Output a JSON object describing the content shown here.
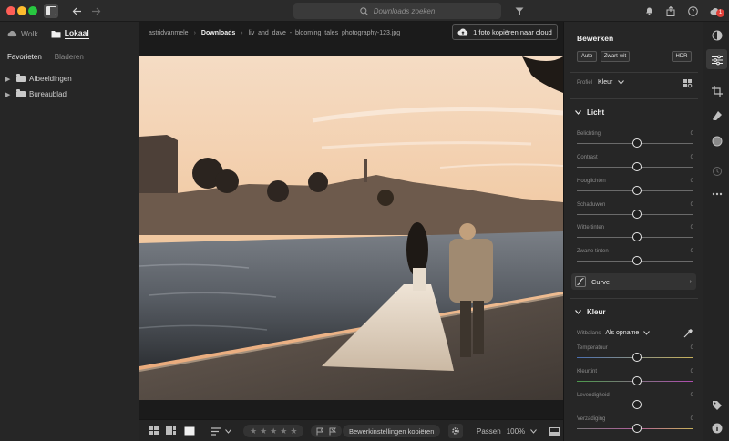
{
  "search": {
    "placeholder": "Downloads zoeken"
  },
  "left_panel": {
    "source_tabs": [
      {
        "label": "Wolk"
      },
      {
        "label": "Lokaal"
      }
    ],
    "sub_tabs": [
      {
        "label": "Favorieten"
      },
      {
        "label": "Bladeren"
      }
    ],
    "tree": [
      {
        "label": "Afbeeldingen"
      },
      {
        "label": "Bureaublad"
      }
    ]
  },
  "breadcrumb": {
    "root": "astridvanmele",
    "folder": "Downloads",
    "file": "liv_and_dave_-_blooming_tales_photography-123.jpg"
  },
  "cloud_button": {
    "label": "1 foto kopiëren naar cloud"
  },
  "bottom_bar": {
    "copy_settings": "Bewerkinstellingen kopiëren",
    "fit_label": "Passen",
    "zoom": "100%"
  },
  "edit_panel": {
    "title": "Bewerken",
    "buttons": {
      "auto": "Auto",
      "bw": "Zwart-wit",
      "hdr": "HDR"
    },
    "profile": {
      "label": "Profiel",
      "value": "Kleur"
    },
    "light": {
      "title": "Licht",
      "sliders": [
        {
          "label": "Belichting",
          "value": "0"
        },
        {
          "label": "Contrast",
          "value": "0"
        },
        {
          "label": "Hooglichten",
          "value": "0"
        },
        {
          "label": "Schaduwen",
          "value": "0"
        },
        {
          "label": "Witte tinten",
          "value": "0"
        },
        {
          "label": "Zwarte tinten",
          "value": "0"
        }
      ]
    },
    "curve": {
      "label": "Curve"
    },
    "color": {
      "title": "Kleur",
      "white_balance": {
        "label": "Witbalans",
        "value": "Als opname"
      },
      "sliders": [
        {
          "label": "Temperatuur",
          "value": "0"
        },
        {
          "label": "Kleurtint",
          "value": "0"
        },
        {
          "label": "Levendigheid",
          "value": "0"
        },
        {
          "label": "Verzadiging",
          "value": "0"
        }
      ]
    }
  },
  "notification_badge": "1"
}
